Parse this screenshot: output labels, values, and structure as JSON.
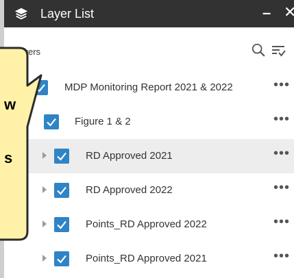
{
  "window": {
    "title": "Layer List",
    "minimize": "–",
    "close": "✕",
    "icon": "layers-icon"
  },
  "toolbar": {
    "label": "Layers",
    "search_icon": "search-icon",
    "filter_icon": "filter-icon"
  },
  "layers": [
    {
      "label": "MDP Monitoring Report 2021 & 2022",
      "checked": true,
      "expandable": false,
      "more": "•••"
    },
    {
      "label": "Figure 1 & 2",
      "checked": true,
      "expandable": false,
      "more": "•••"
    },
    {
      "label": "RD Approved 2021",
      "checked": true,
      "expandable": true,
      "selected": true,
      "more": "•••"
    },
    {
      "label": "RD Approved 2022",
      "checked": true,
      "expandable": true,
      "more": "•••"
    },
    {
      "label": "Points_RD Approved 2022",
      "checked": true,
      "expandable": true,
      "more": "•••"
    },
    {
      "label": "Points_RD Approved 2021",
      "checked": true,
      "expandable": true,
      "more": "•••"
    }
  ],
  "callout": {
    "text_1": "w",
    "text_2": "s"
  },
  "colors": {
    "titlebar": "#323232",
    "checkbox": "#2f84c6",
    "row_highlight": "#ededed",
    "callout_fill": "#fff2a8",
    "callout_border": "#2b2b2b"
  }
}
